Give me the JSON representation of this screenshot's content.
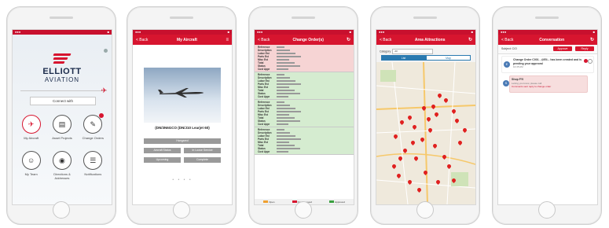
{
  "screen1": {
    "logo_word": "ELLIOTT",
    "logo_sub": "AVIATION",
    "connect_label": "Connect with",
    "tiles": [
      {
        "label": "My Aircraft",
        "icon": "aircraft-icon",
        "glyph": "✈",
        "accent": true,
        "badge": false
      },
      {
        "label": "Asset Projects",
        "icon": "document-icon",
        "glyph": "▤",
        "accent": false,
        "badge": false
      },
      {
        "label": "Change Orders",
        "icon": "change-orders-icon",
        "glyph": "✎",
        "accent": false,
        "badge": true
      },
      {
        "label": "My Team",
        "icon": "team-icon",
        "glyph": "☺",
        "accent": false,
        "badge": false
      },
      {
        "label": "Directions & Addresses",
        "icon": "location-icon",
        "glyph": "◉",
        "accent": false,
        "badge": false
      },
      {
        "label": "Notifications",
        "icon": "notification-icon",
        "glyph": "☰",
        "accent": false,
        "badge": false
      }
    ]
  },
  "screen2": {
    "nav_back": "< Back",
    "nav_title": "My Aircraft",
    "aircraft_title": "(DN/3N6GCO (DN/J10 Learjet 60)",
    "buttons": [
      "Hangared",
      "Aircraft Status",
      "In Loose Service",
      "Upcoming",
      "Complete"
    ]
  },
  "screen3": {
    "nav_back": "< Back",
    "nav_title": "Change Order(s)",
    "field_labels": [
      "Reference",
      "Description",
      "Labor Est",
      "Parts Est",
      "Misc Est",
      "Total",
      "Status",
      "Cust Appr"
    ],
    "legend": [
      "Open",
      "Not Approved",
      "Approved"
    ]
  },
  "screen4": {
    "nav_back": "< Back",
    "nav_title": "Area Attractions",
    "filter_label": "Category",
    "filter_value": "All",
    "seg_list": "List",
    "seg_map": "Map"
  },
  "screen5": {
    "nav_back": "< Back",
    "nav_title": "Conversation",
    "subject": "Subject: C/O",
    "btn_approve": "Approve",
    "btn_reply": "Reply",
    "msg1_title": "Change Order C001 - @Ell... has been created and is pending your approval",
    "msg1_time": "10:45 AM",
    "msg2_title": "Shop FYI",
    "msg2_body": "Letting you know, please call",
    "msg2_link": "Comments sent reply to change order"
  },
  "colors": {
    "brand_red": "#d7152f",
    "map_blue": "#2a7ab0"
  }
}
